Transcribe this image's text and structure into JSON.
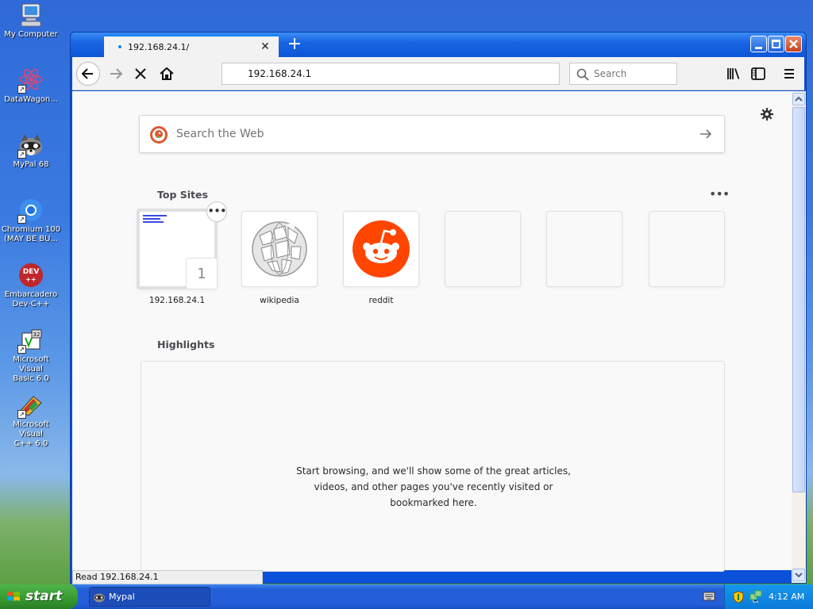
{
  "desktop": {
    "icons": [
      {
        "label": "My Computer"
      },
      {
        "label": "DataWagon..."
      },
      {
        "label": "MyPal 68"
      },
      {
        "label": "Chromium 100\n(MAY BE BU..."
      },
      {
        "label": "Embarcadero\nDev-C++"
      },
      {
        "label": "Microsoft Visual\nBasic 6.0"
      },
      {
        "label": "Microsoft Visual\nC++ 6.0"
      }
    ],
    "devcpp_badge": "DEV"
  },
  "browser": {
    "tab": {
      "title": "192.168.24.1/"
    },
    "url": "192.168.24.1",
    "search_placeholder": "Search",
    "newtab": {
      "search_placeholder": "Search the Web",
      "top_sites_title": "Top Sites",
      "top_sites": [
        {
          "name": "192.168.24.1",
          "badge": "1"
        },
        {
          "name": "wikipedia"
        },
        {
          "name": "reddit"
        },
        {
          "name": ""
        },
        {
          "name": ""
        },
        {
          "name": ""
        }
      ],
      "highlights_title": "Highlights",
      "highlights_empty": [
        "Start browsing, and we'll show some of the great articles,",
        "videos, and other pages you've recently visited or",
        "bookmarked here."
      ]
    },
    "status": "Read 192.168.24.1"
  },
  "taskbar": {
    "start_label": "start",
    "tasks": [
      {
        "label": "Mypal"
      }
    ],
    "clock": "4:12 AM"
  },
  "colors": {
    "accent": "#0a84ff",
    "reddit": "#ff4500",
    "xp_blue": "#245ed8",
    "xp_start": "#35992f"
  }
}
